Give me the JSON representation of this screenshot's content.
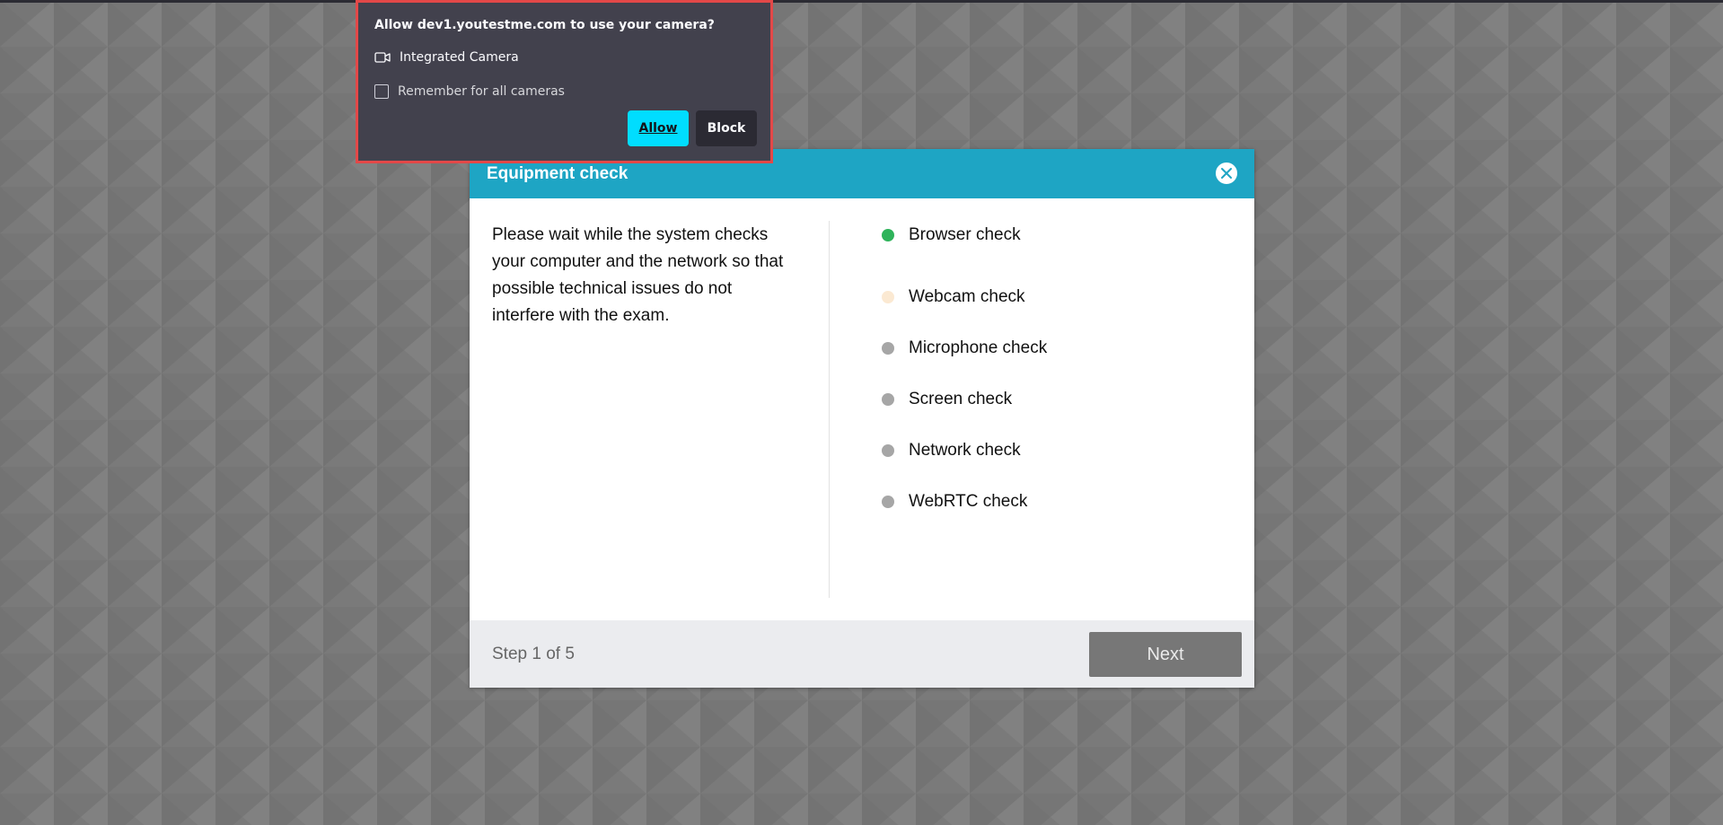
{
  "colors": {
    "background": "#7a7a7a",
    "header": "#1ea5c4",
    "status_passed": "#2eb35a",
    "status_in_progress": "#fbe9d2",
    "status_pending": "#a6a6a6",
    "next_button": "#777777",
    "allow_button": "#00ddff",
    "popup_border": "#e34848"
  },
  "permission_popup": {
    "title": "Allow dev1.youtestme.com to use your camera?",
    "device_icon": "camera-icon",
    "device_label": "Integrated Camera",
    "remember_label": "Remember for all cameras",
    "remember_checked": false,
    "allow_label": "Allow",
    "block_label": "Block"
  },
  "modal": {
    "title": "Equipment check",
    "close_icon": "close-circle-icon",
    "description": "Please wait while the system checks your computer and the network so that possible technical issues do not interfere with the exam.",
    "checks": [
      {
        "label": "Browser check",
        "status": "passed"
      },
      {
        "label": "Webcam check",
        "status": "in_progress"
      },
      {
        "label": "Microphone check",
        "status": "pending"
      },
      {
        "label": "Screen check",
        "status": "pending"
      },
      {
        "label": "Network check",
        "status": "pending"
      },
      {
        "label": "WebRTC check",
        "status": "pending"
      }
    ],
    "step_text": "Step 1 of 5",
    "next_label": "Next"
  }
}
